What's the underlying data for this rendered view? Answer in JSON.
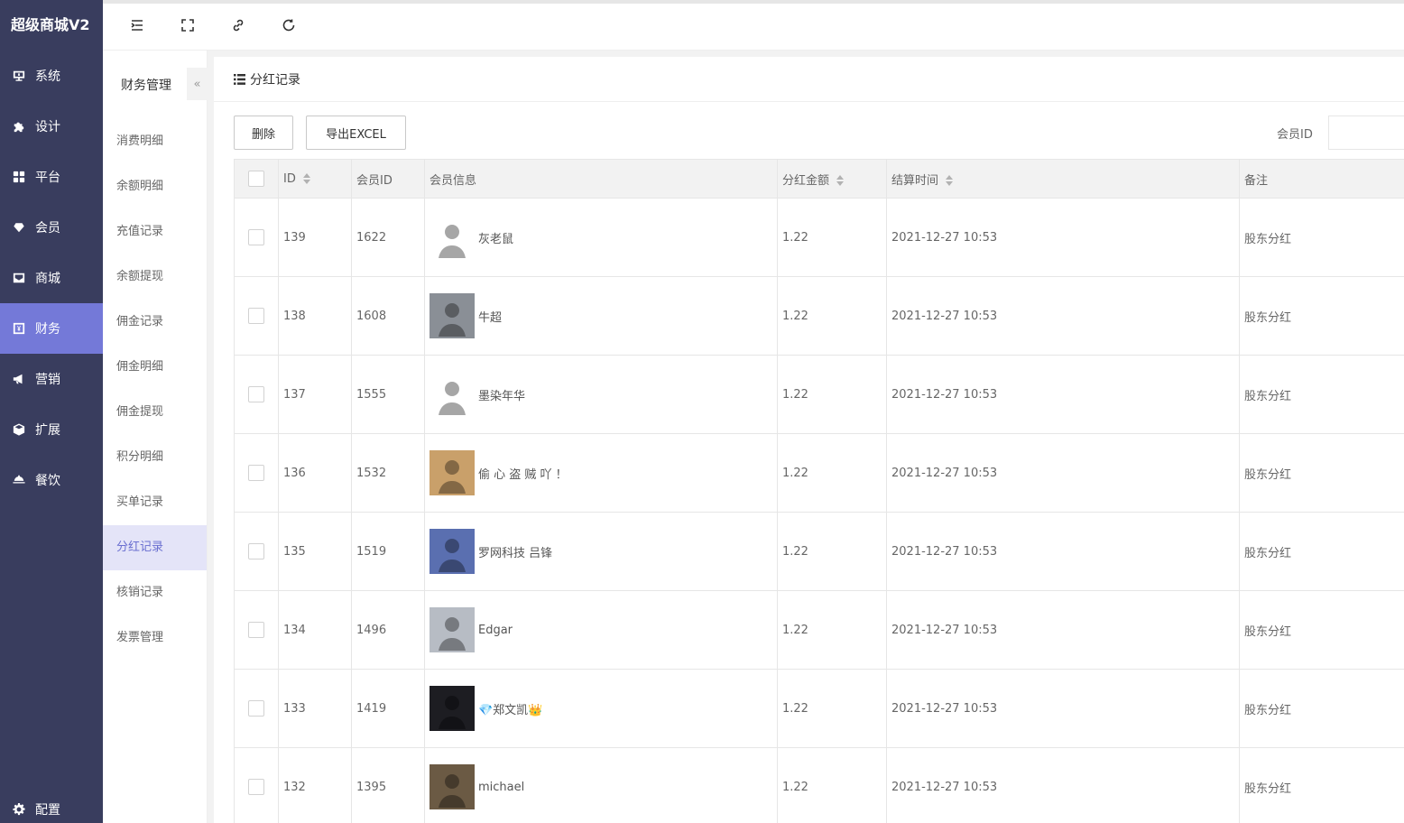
{
  "app": {
    "title": "超级商城V2"
  },
  "sidebar": {
    "items": [
      {
        "label": "系统",
        "icon": "monitor-icon",
        "active": false
      },
      {
        "label": "设计",
        "icon": "puzzle-icon",
        "active": false
      },
      {
        "label": "平台",
        "icon": "grid-icon",
        "active": false
      },
      {
        "label": "会员",
        "icon": "heart-icon",
        "active": false
      },
      {
        "label": "商城",
        "icon": "inbox-icon",
        "active": false
      },
      {
        "label": "财务",
        "icon": "money-icon",
        "active": true
      },
      {
        "label": "营销",
        "icon": "megaphone-icon",
        "active": false
      },
      {
        "label": "扩展",
        "icon": "cube-icon",
        "active": false
      },
      {
        "label": "餐饮",
        "icon": "cloche-icon",
        "active": false
      }
    ],
    "config_label": "配置"
  },
  "topbar": {
    "buttons": [
      "menu-indent-icon",
      "fullscreen-icon",
      "link-icon",
      "refresh-icon"
    ]
  },
  "subsidebar": {
    "title": "财务管理",
    "collapse_glyph": "«",
    "items": [
      {
        "label": "消费明细",
        "active": false
      },
      {
        "label": "余额明细",
        "active": false
      },
      {
        "label": "充值记录",
        "active": false
      },
      {
        "label": "余额提现",
        "active": false
      },
      {
        "label": "佣金记录",
        "active": false
      },
      {
        "label": "佣金明细",
        "active": false
      },
      {
        "label": "佣金提现",
        "active": false
      },
      {
        "label": "积分明细",
        "active": false
      },
      {
        "label": "买单记录",
        "active": false
      },
      {
        "label": "分红记录",
        "active": true
      },
      {
        "label": "核销记录",
        "active": false
      },
      {
        "label": "发票管理",
        "active": false
      }
    ]
  },
  "main": {
    "title": "分红记录",
    "toolbar": {
      "delete_label": "删除",
      "export_label": "导出EXCEL",
      "filter_label": "会员ID",
      "filter_value": ""
    },
    "table": {
      "headers": {
        "id": "ID",
        "member_id": "会员ID",
        "member_info": "会员信息",
        "amount": "分红金额",
        "settle_time": "结算时间",
        "remark": "备注"
      },
      "rows": [
        {
          "id": "139",
          "member_id": "1622",
          "name": "灰老鼠",
          "amount": "1.22",
          "time": "2021-12-27 10:53",
          "remark": "股东分红",
          "avatar_color": "#ffffff"
        },
        {
          "id": "138",
          "member_id": "1608",
          "name": "牛超",
          "amount": "1.22",
          "time": "2021-12-27 10:53",
          "remark": "股东分红",
          "avatar_color": "#8a8f96"
        },
        {
          "id": "137",
          "member_id": "1555",
          "name": "墨染年华",
          "amount": "1.22",
          "time": "2021-12-27 10:53",
          "remark": "股东分红",
          "avatar_color": "#ffffff"
        },
        {
          "id": "136",
          "member_id": "1532",
          "name": "偷 心 盗 贼 吖 ！",
          "amount": "1.22",
          "time": "2021-12-27 10:53",
          "remark": "股东分红",
          "avatar_color": "#c9a06a"
        },
        {
          "id": "135",
          "member_id": "1519",
          "name": "罗网科技 吕锋",
          "amount": "1.22",
          "time": "2021-12-27 10:53",
          "remark": "股东分红",
          "avatar_color": "#5a6fb0"
        },
        {
          "id": "134",
          "member_id": "1496",
          "name": "Edgar",
          "amount": "1.22",
          "time": "2021-12-27 10:53",
          "remark": "股东分红",
          "avatar_color": "#b7bcc4"
        },
        {
          "id": "133",
          "member_id": "1419",
          "name": "💎郑文凯👑",
          "amount": "1.22",
          "time": "2021-12-27 10:53",
          "remark": "股东分红",
          "avatar_color": "#1d1d22"
        },
        {
          "id": "132",
          "member_id": "1395",
          "name": "michael",
          "amount": "1.22",
          "time": "2021-12-27 10:53",
          "remark": "股东分红",
          "avatar_color": "#6b5a44"
        }
      ]
    }
  },
  "colors": {
    "sidebar_bg": "#393d5e",
    "sidebar_active": "#7479d8",
    "sub_active_bg": "#e4e4f8",
    "sub_active_text": "#6a6fd0"
  }
}
